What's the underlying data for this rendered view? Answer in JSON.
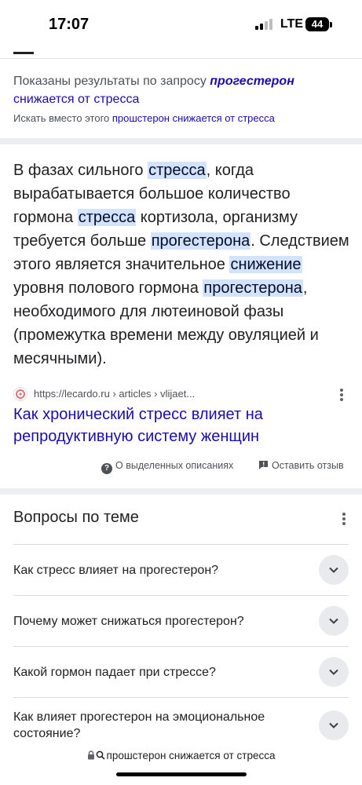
{
  "status_bar": {
    "time": "17:07",
    "network": "LTE",
    "battery": "44"
  },
  "spelling": {
    "shown_prefix": "Показаны результаты по запросу ",
    "shown_bold": "прогестерон",
    "shown_rest": "снижается от стресса",
    "instead_prefix": "Искать вместо этого ",
    "instead_link": "прошстерон снижается от стресса"
  },
  "snippet": {
    "parts": [
      "В фазах сильного ",
      "стресса",
      ", когда вырабатывается большое количество гормона ",
      "стресса",
      " кортизола, организму требуется больше ",
      "прогестерона",
      ". Следствием этого является значительное ",
      "снижение",
      " уровня полового гормона ",
      "прогестерона",
      ", необходимого для лютеиновой фазы (промежутка времени между овуляцией и месячными)."
    ],
    "source_url": "https://lecardo.ru › articles › vlijaet...",
    "result_title": "Как хронический стресс влияет на репродуктивную систему женщин",
    "about_label": "О выделенных описаниях",
    "feedback_label": "Оставить отзыв"
  },
  "paa": {
    "title": "Вопросы по теме",
    "questions": [
      "Как стресс влияет на прогестерон?",
      "Почему может снижаться прогестерон?",
      "Какой гормон падает при стрессе?",
      "Как влияет прогестерон на эмоциональное состояние?"
    ]
  },
  "address_bar": {
    "text": "прошстерон снижается от стресса"
  },
  "colors": {
    "link": "#1a0dab",
    "highlight": "#d3e3fd",
    "text": "#202124",
    "secondary": "#4d5156"
  }
}
